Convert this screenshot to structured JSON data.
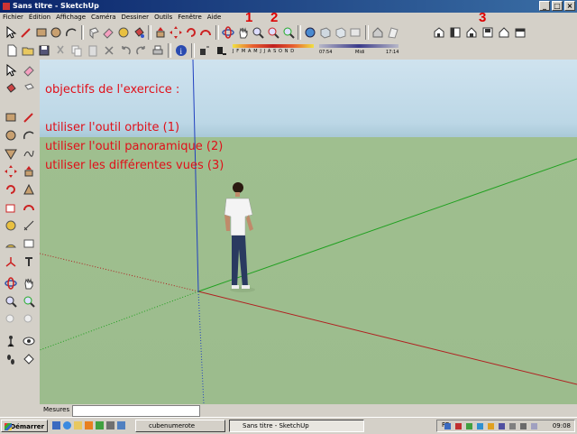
{
  "window": {
    "title": "Sans titre - SketchUp"
  },
  "menu": [
    "Fichier",
    "Édition",
    "Affichage",
    "Caméra",
    "Dessiner",
    "Outils",
    "Fenêtre",
    "Aide"
  ],
  "shadow_bar": {
    "months": "J F M A M J J A S O N D",
    "time_start": "07:54",
    "mid": "Midi",
    "time_end": "17:14"
  },
  "annotations": {
    "heading": "objectifs de l'exercice :",
    "line1": "utiliser l'outil orbite (1)",
    "line2": "utiliser l'outil panoramique (2)",
    "line3": "utiliser les différentes vues (3)"
  },
  "markers": {
    "m1": "1",
    "m2": "2",
    "m3": "3"
  },
  "status": {
    "label": "Mesures"
  },
  "taskbar": {
    "start": "Démarrer",
    "task1": "cubenumerote",
    "task2": "Sans titre - SketchUp",
    "lang": "FR",
    "clock": "09:08"
  },
  "colors": {
    "annotation": "#e0101a",
    "sky": "#bcd7e6",
    "ground": "#9fbf8f",
    "red_axis": "#b02020",
    "green_axis": "#20a020",
    "blue_axis": "#2040c0"
  }
}
